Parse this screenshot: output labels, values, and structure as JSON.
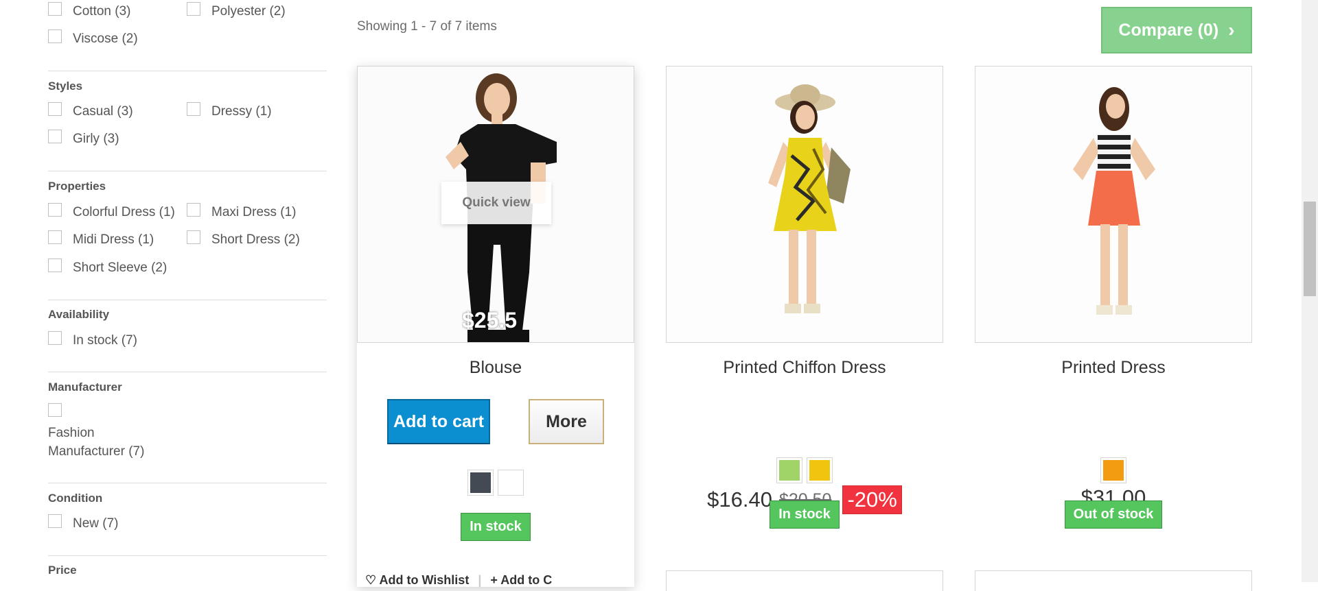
{
  "filters": {
    "composition": {
      "options": [
        {
          "label": "Cotton (3)"
        },
        {
          "label": "Polyester (2)"
        },
        {
          "label": "Viscose (2)"
        }
      ]
    },
    "styles": {
      "title": "Styles",
      "options": [
        {
          "label": "Casual (3)"
        },
        {
          "label": "Dressy (1)"
        },
        {
          "label": "Girly (3)"
        }
      ]
    },
    "properties": {
      "title": "Properties",
      "options": [
        {
          "label": "Colorful Dress (1)"
        },
        {
          "label": "Maxi Dress (1)"
        },
        {
          "label": "Midi Dress (1)"
        },
        {
          "label": "Short Dress (2)"
        },
        {
          "label": "Short Sleeve (2)"
        }
      ]
    },
    "availability": {
      "title": "Availability",
      "options": [
        {
          "label": "In stock (7)"
        }
      ]
    },
    "manufacturer": {
      "title": "Manufacturer",
      "options": [
        {
          "label": "Fashion Manufacturer (7)"
        }
      ]
    },
    "condition": {
      "title": "Condition",
      "options": [
        {
          "label": "New (7)"
        }
      ]
    },
    "price": {
      "title": "Price"
    }
  },
  "listing": {
    "showing_text": "Showing 1 - 7 of 7 items",
    "compare_label": "Compare (0)"
  },
  "products": [
    {
      "name": "Blouse",
      "image_price": "$25.5",
      "quick_view": "Quick view",
      "add_to_cart": "Add to cart",
      "more": "More",
      "colors": [
        "#434a54",
        "#ffffff"
      ],
      "stock": "In stock",
      "wishlist": "Add to Wishlist",
      "compare": "Add to C"
    },
    {
      "name": "Printed Chiffon Dress",
      "price": "$16.40",
      "old_price": "$20.50",
      "discount": "-20%",
      "colors": [
        "#a0d468",
        "#f1c40f"
      ],
      "stock": "In stock"
    },
    {
      "name": "Printed Dress",
      "price": "$31.00",
      "colors": [
        "#f39c11"
      ],
      "stock": "Out of stock"
    }
  ]
}
